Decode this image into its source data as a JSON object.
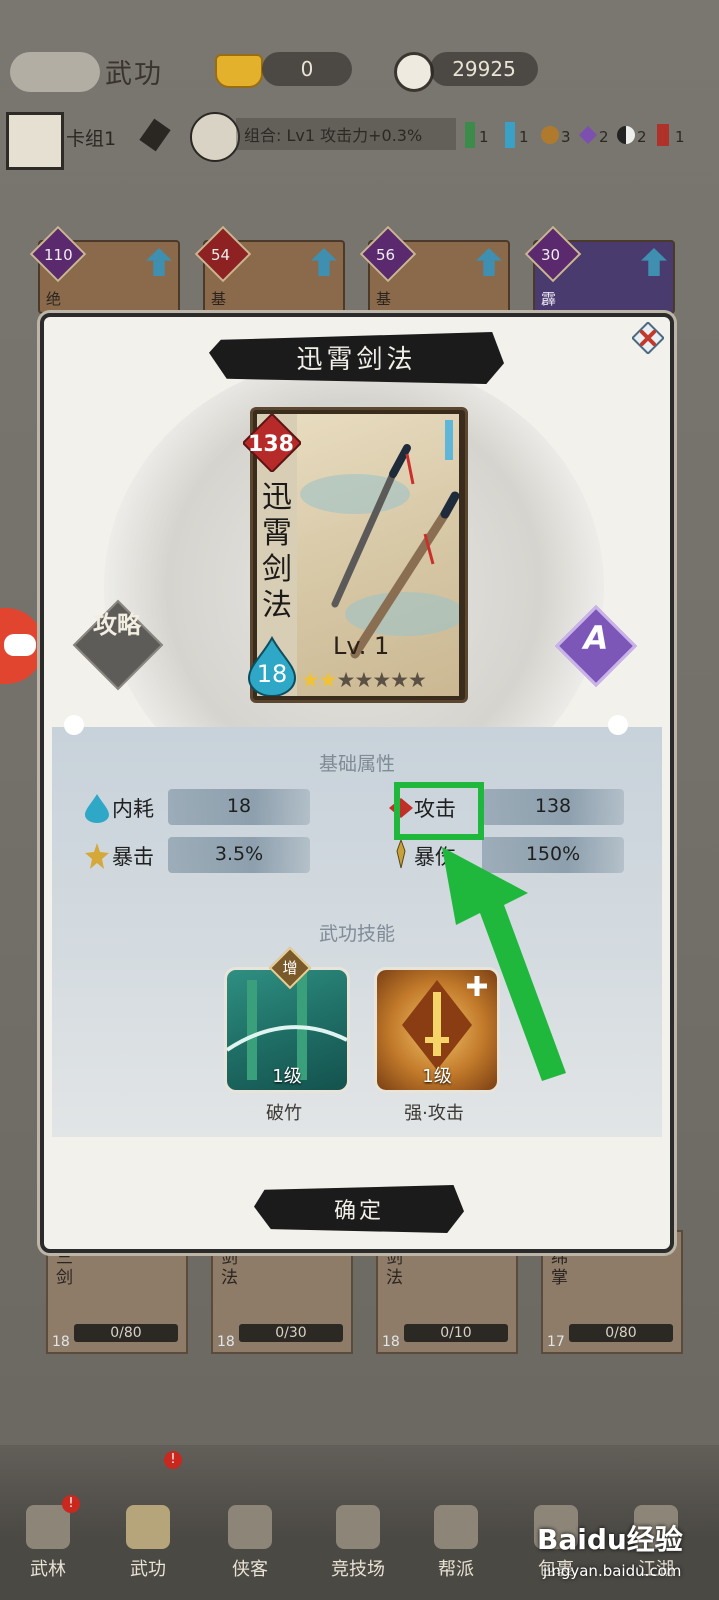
{
  "header": {
    "screen_title": "武功",
    "gold": "0",
    "coins": "29925"
  },
  "deck": {
    "name": "卡组1",
    "combo": "组合: Lv1 攻击力+0.3%",
    "counts": [
      "1",
      "1",
      "3",
      "2",
      "2",
      "1"
    ]
  },
  "background_cards": [
    {
      "level": "110",
      "label": "绝"
    },
    {
      "level": "54",
      "label": "基"
    },
    {
      "level": "56",
      "label": "基"
    },
    {
      "level": "30",
      "label": "霹"
    }
  ],
  "bottom_cards": [
    {
      "label": "三剑",
      "progress": "0/80",
      "cost": "18"
    },
    {
      "label": "剑法",
      "progress": "0/30",
      "cost": "18"
    },
    {
      "label": "剑法",
      "progress": "0/10",
      "cost": "18"
    },
    {
      "label": "绵掌",
      "progress": "0/80",
      "cost": "17"
    }
  ],
  "dialog": {
    "title": "迅霄剑法",
    "card": {
      "name": "迅霄剑法",
      "power": "138",
      "cost": "18",
      "level": "Lv. 1",
      "stars_filled": 2,
      "stars_total": 7
    },
    "guide_label": "攻略",
    "rank": "A",
    "basic_attrs_title": "基础属性",
    "stats": [
      {
        "label": "内耗",
        "value": "18"
      },
      {
        "label": "攻击",
        "value": "138"
      },
      {
        "label": "暴击",
        "value": "3.5%"
      },
      {
        "label": "暴伤",
        "value": "150%"
      }
    ],
    "skills_title": "武功技能",
    "skills": [
      {
        "name": "破竹",
        "level": "1级",
        "badge": "增"
      },
      {
        "name": "强·攻击",
        "level": "1级"
      }
    ],
    "confirm_label": "确定"
  },
  "nav": [
    {
      "label": "武林"
    },
    {
      "label": "武功"
    },
    {
      "label": "侠客"
    },
    {
      "label": "竞技场"
    },
    {
      "label": "帮派"
    },
    {
      "label": "包裹"
    },
    {
      "label": "江湖"
    }
  ],
  "annotation": {
    "color": "#20b83c"
  },
  "watermark": {
    "brand": "Baidu经验",
    "url": "jingyan.baidu.com"
  }
}
